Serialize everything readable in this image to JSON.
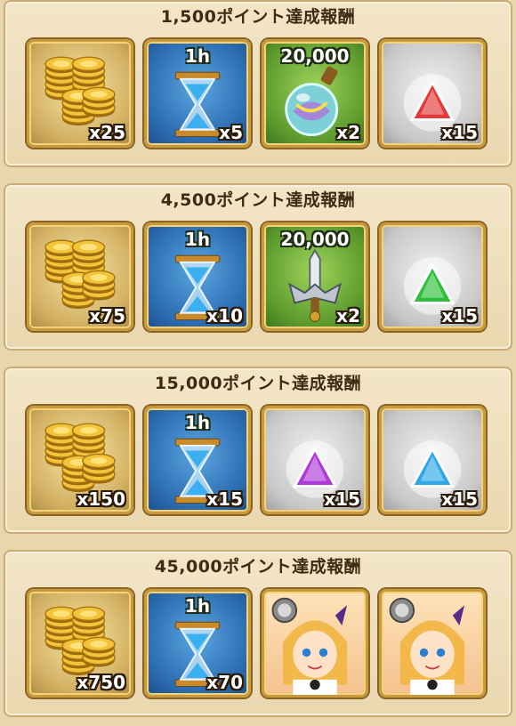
{
  "panels": [
    {
      "title": "1,500ポイント達成報酬",
      "items": [
        {
          "type": "coins",
          "icon": "gold-coins-icon",
          "count": "x25"
        },
        {
          "type": "hourglass",
          "icon": "hourglass-icon",
          "label": "1h",
          "count": "x5"
        },
        {
          "type": "potion",
          "icon": "potion-icon",
          "label": "20,000",
          "count": "x2"
        },
        {
          "type": "gem",
          "icon": "red-gem-icon",
          "gem_color": "#e23a3a",
          "count": "x15"
        }
      ]
    },
    {
      "title": "4,500ポイント達成報酬",
      "items": [
        {
          "type": "coins",
          "icon": "gold-coins-icon",
          "count": "x75"
        },
        {
          "type": "hourglass",
          "icon": "hourglass-icon",
          "label": "1h",
          "count": "x10"
        },
        {
          "type": "sword",
          "icon": "sword-icon",
          "label": "20,000",
          "count": "x2"
        },
        {
          "type": "gem",
          "icon": "green-gem-icon",
          "gem_color": "#2fbf3a",
          "count": "x15"
        }
      ]
    },
    {
      "title": "15,000ポイント達成報酬",
      "items": [
        {
          "type": "coins",
          "icon": "gold-coins-icon",
          "count": "x150"
        },
        {
          "type": "hourglass",
          "icon": "hourglass-icon",
          "label": "1h",
          "count": "x15"
        },
        {
          "type": "gem",
          "icon": "purple-gem-icon",
          "gem_color": "#b03ad8",
          "count": "x15"
        },
        {
          "type": "gem",
          "icon": "blue-gem-icon",
          "gem_color": "#2fa8e6",
          "count": "x15"
        }
      ]
    },
    {
      "title": "45,000ポイント達成報酬",
      "items": [
        {
          "type": "coins",
          "icon": "gold-coins-icon",
          "count": "x750"
        },
        {
          "type": "hourglass",
          "icon": "hourglass-icon",
          "label": "1h",
          "count": "x70"
        },
        {
          "type": "portrait",
          "icon": "character-portrait-icon",
          "count": ""
        },
        {
          "type": "portrait",
          "icon": "character-portrait-icon",
          "count": ""
        }
      ]
    }
  ]
}
